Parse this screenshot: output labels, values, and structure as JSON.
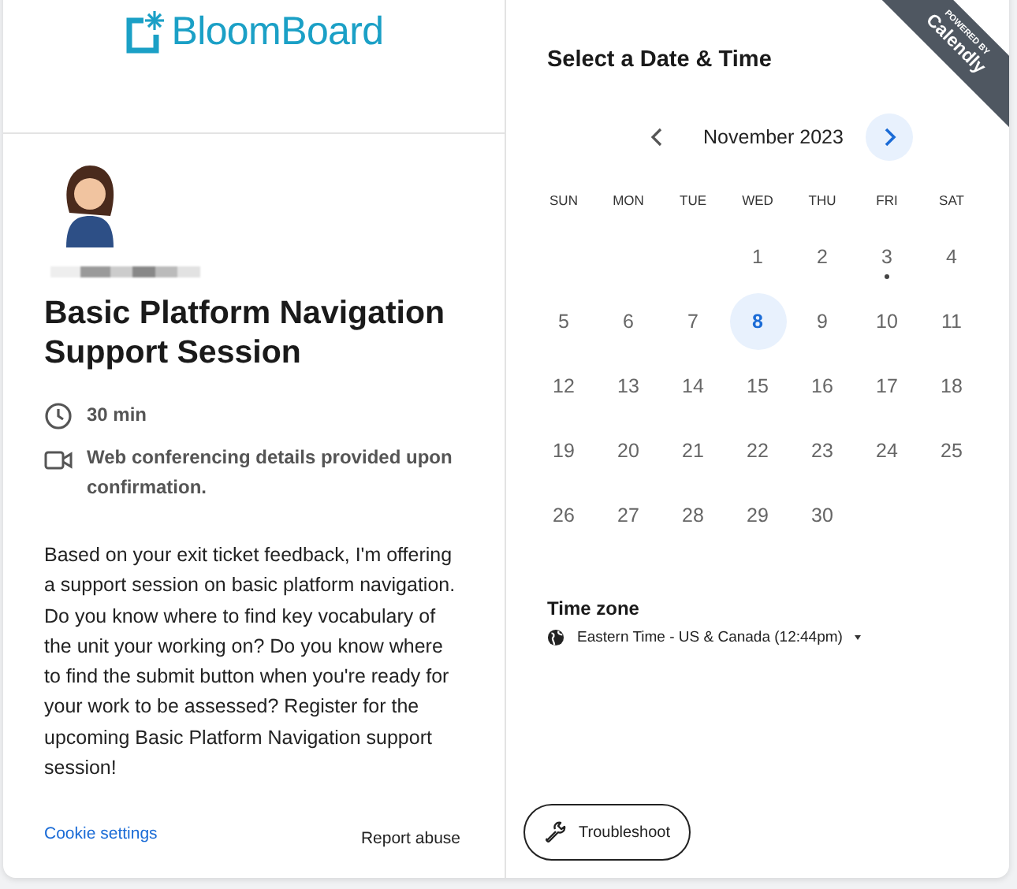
{
  "logo": {
    "text": "BloomBoard"
  },
  "event": {
    "title": "Basic Platform Navigation Support Session",
    "duration": "30 min",
    "location": "Web conferencing details provided upon confirmation.",
    "description": "Based on your exit ticket feedback, I'm offering a support session on basic platform navigation. Do you know where to find key vocabulary of the unit your working on? Do you know where to find the submit button when you're ready for your work to be assessed? Register for the upcoming Basic Platform Navigation support session!"
  },
  "footer": {
    "cookie_link": "Cookie settings",
    "report_link": "Report abuse"
  },
  "badge": {
    "caption": "POWERED BY",
    "brand": "Calendly"
  },
  "picker": {
    "title": "Select a Date & Time",
    "month": "November 2023",
    "weekdays": [
      "SUN",
      "MON",
      "TUE",
      "WED",
      "THU",
      "FRI",
      "SAT"
    ],
    "weeks": [
      {
        "days": [
          {
            "label": "1",
            "available": false,
            "today": false,
            "selected": false
          },
          {
            "label": "2",
            "available": false,
            "today": false,
            "selected": false
          },
          {
            "label": "3",
            "available": false,
            "today": true,
            "selected": false
          },
          {
            "label": "4",
            "available": false,
            "today": false,
            "selected": false
          }
        ]
      },
      {
        "days": [
          {
            "label": "5",
            "available": false,
            "today": false,
            "selected": false
          },
          {
            "label": "6",
            "available": false,
            "today": false,
            "selected": false
          },
          {
            "label": "7",
            "available": false,
            "today": false,
            "selected": false
          },
          {
            "label": "8",
            "available": true,
            "today": false,
            "selected": false
          },
          {
            "label": "9",
            "available": false,
            "today": false,
            "selected": false
          },
          {
            "label": "10",
            "available": false,
            "today": false,
            "selected": false
          },
          {
            "label": "11",
            "available": false,
            "today": false,
            "selected": false
          }
        ]
      },
      {
        "days": [
          {
            "label": "12",
            "available": false,
            "today": false,
            "selected": false
          },
          {
            "label": "13",
            "available": false,
            "today": false,
            "selected": false
          },
          {
            "label": "14",
            "available": false,
            "today": false,
            "selected": false
          },
          {
            "label": "15",
            "available": false,
            "today": false,
            "selected": false
          },
          {
            "label": "16",
            "available": false,
            "today": false,
            "selected": false
          },
          {
            "label": "17",
            "available": false,
            "today": false,
            "selected": false
          },
          {
            "label": "18",
            "available": false,
            "today": false,
            "selected": false
          }
        ]
      },
      {
        "days": [
          {
            "label": "19",
            "available": false,
            "today": false,
            "selected": false
          },
          {
            "label": "20",
            "available": false,
            "today": false,
            "selected": false
          },
          {
            "label": "21",
            "available": false,
            "today": false,
            "selected": false
          },
          {
            "label": "22",
            "available": false,
            "today": false,
            "selected": false
          },
          {
            "label": "23",
            "available": false,
            "today": false,
            "selected": false
          },
          {
            "label": "24",
            "available": false,
            "today": false,
            "selected": false
          },
          {
            "label": "25",
            "available": false,
            "today": false,
            "selected": false
          }
        ]
      },
      {
        "days": [
          {
            "label": "26",
            "available": false,
            "today": false,
            "selected": false
          },
          {
            "label": "27",
            "available": false,
            "today": false,
            "selected": false
          },
          {
            "label": "28",
            "available": false,
            "today": false,
            "selected": false
          },
          {
            "label": "29",
            "available": false,
            "today": false,
            "selected": false
          },
          {
            "label": "30",
            "available": false,
            "today": false,
            "selected": false
          }
        ]
      }
    ],
    "timezone_label": "Time zone",
    "timezone": "Eastern Time - US & Canada (12:44pm)"
  },
  "troubleshoot": {
    "label": "Troubleshoot"
  }
}
